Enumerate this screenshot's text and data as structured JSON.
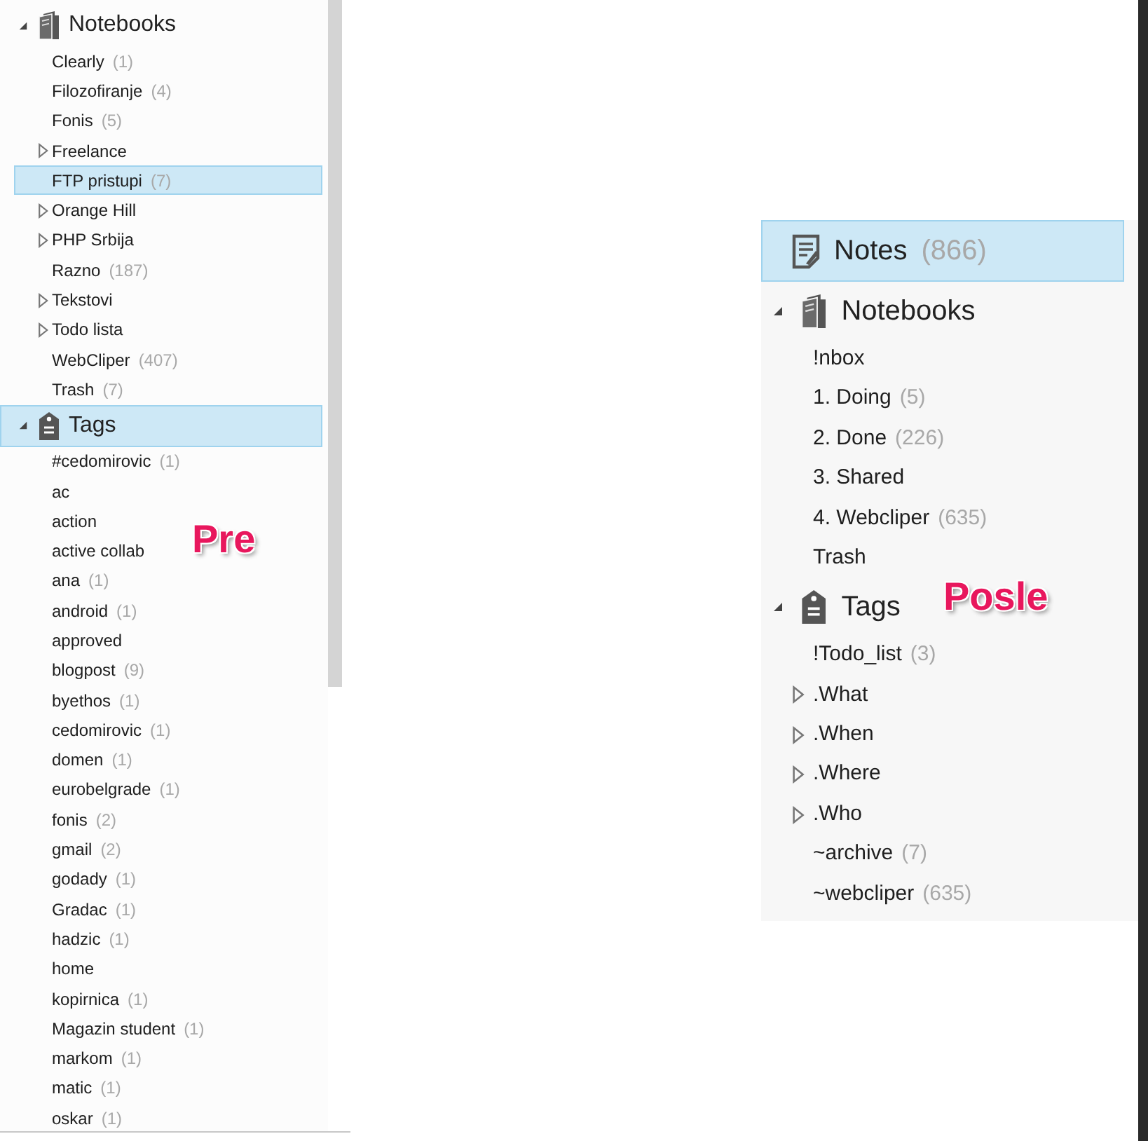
{
  "left_panel": {
    "sections": [
      {
        "kind": "notebooks",
        "title": "Notebooks",
        "expanded": true,
        "selected": false,
        "items": [
          {
            "label": "Clearly",
            "count": "(1)",
            "has_children": false,
            "selected": false
          },
          {
            "label": "Filozofiranje",
            "count": "(4)",
            "has_children": false,
            "selected": false
          },
          {
            "label": "Fonis",
            "count": "(5)",
            "has_children": false,
            "selected": false
          },
          {
            "label": "Freelance",
            "has_children": true,
            "selected": false
          },
          {
            "label": "FTP pristupi",
            "count": "(7)",
            "has_children": false,
            "selected": true
          },
          {
            "label": "Orange Hill",
            "has_children": true,
            "selected": false
          },
          {
            "label": "PHP Srbija",
            "has_children": true,
            "selected": false
          },
          {
            "label": "Razno",
            "count": "(187)",
            "has_children": false,
            "selected": false
          },
          {
            "label": "Tekstovi",
            "has_children": true,
            "selected": false
          },
          {
            "label": "Todo lista",
            "has_children": true,
            "selected": false
          },
          {
            "label": "WebCliper",
            "count": "(407)",
            "has_children": false,
            "selected": false
          },
          {
            "label": "Trash",
            "count": "(7)",
            "has_children": false,
            "selected": false
          }
        ]
      },
      {
        "kind": "tags",
        "title": "Tags",
        "expanded": true,
        "selected": true,
        "items": [
          {
            "label": "#cedomirovic",
            "count": "(1)",
            "has_children": false,
            "selected": false
          },
          {
            "label": "ac",
            "has_children": false,
            "selected": false
          },
          {
            "label": "action",
            "has_children": false,
            "selected": false
          },
          {
            "label": "active collab",
            "has_children": false,
            "selected": false
          },
          {
            "label": "ana",
            "count": "(1)",
            "has_children": false,
            "selected": false
          },
          {
            "label": "android",
            "count": "(1)",
            "has_children": false,
            "selected": false
          },
          {
            "label": "approved",
            "has_children": false,
            "selected": false
          },
          {
            "label": "blogpost",
            "count": "(9)",
            "has_children": false,
            "selected": false
          },
          {
            "label": "byethos",
            "count": "(1)",
            "has_children": false,
            "selected": false
          },
          {
            "label": "cedomirovic",
            "count": "(1)",
            "has_children": false,
            "selected": false
          },
          {
            "label": "domen",
            "count": "(1)",
            "has_children": false,
            "selected": false
          },
          {
            "label": "eurobelgrade",
            "count": "(1)",
            "has_children": false,
            "selected": false
          },
          {
            "label": "fonis",
            "count": "(2)",
            "has_children": false,
            "selected": false
          },
          {
            "label": "gmail",
            "count": "(2)",
            "has_children": false,
            "selected": false
          },
          {
            "label": "godady",
            "count": "(1)",
            "has_children": false,
            "selected": false
          },
          {
            "label": "Gradac",
            "count": "(1)",
            "has_children": false,
            "selected": false
          },
          {
            "label": "hadzic",
            "count": "(1)",
            "has_children": false,
            "selected": false
          },
          {
            "label": "home",
            "has_children": false,
            "selected": false
          },
          {
            "label": "kopirnica",
            "count": "(1)",
            "has_children": false,
            "selected": false
          },
          {
            "label": "Magazin student",
            "count": "(1)",
            "has_children": false,
            "selected": false
          },
          {
            "label": "markom",
            "count": "(1)",
            "has_children": false,
            "selected": false
          },
          {
            "label": "matic",
            "count": "(1)",
            "has_children": false,
            "selected": false
          },
          {
            "label": "oskar",
            "count": "(1)",
            "has_children": false,
            "selected": false
          }
        ]
      }
    ]
  },
  "right_panel": {
    "notes": {
      "label": "Notes",
      "count": "(866)",
      "selected": true
    },
    "sections": [
      {
        "kind": "notebooks",
        "title": "Notebooks",
        "expanded": true,
        "selected": false,
        "items": [
          {
            "label": "!nbox",
            "has_children": false,
            "selected": false
          },
          {
            "label": "1. Doing",
            "count": "(5)",
            "has_children": false,
            "selected": false
          },
          {
            "label": "2. Done",
            "count": "(226)",
            "has_children": false,
            "selected": false
          },
          {
            "label": "3. Shared",
            "has_children": false,
            "selected": false
          },
          {
            "label": "4. Webcliper",
            "count": "(635)",
            "has_children": false,
            "selected": false
          },
          {
            "label": "Trash",
            "has_children": false,
            "selected": false
          }
        ]
      },
      {
        "kind": "tags",
        "title": "Tags",
        "expanded": true,
        "selected": false,
        "items": [
          {
            "label": "!Todo_list",
            "count": "(3)",
            "has_children": false,
            "selected": false
          },
          {
            "label": ".What",
            "has_children": true,
            "selected": false
          },
          {
            "label": ".When",
            "has_children": true,
            "selected": false
          },
          {
            "label": ".Where",
            "has_children": true,
            "selected": false
          },
          {
            "label": ".Who",
            "has_children": true,
            "selected": false
          },
          {
            "label": "~archive",
            "count": "(7)",
            "has_children": false,
            "selected": false
          },
          {
            "label": "~webcliper",
            "count": "(635)",
            "has_children": false,
            "selected": false
          }
        ]
      }
    ]
  },
  "annotations": [
    {
      "text": "Pre"
    },
    {
      "text": "Posle"
    }
  ]
}
